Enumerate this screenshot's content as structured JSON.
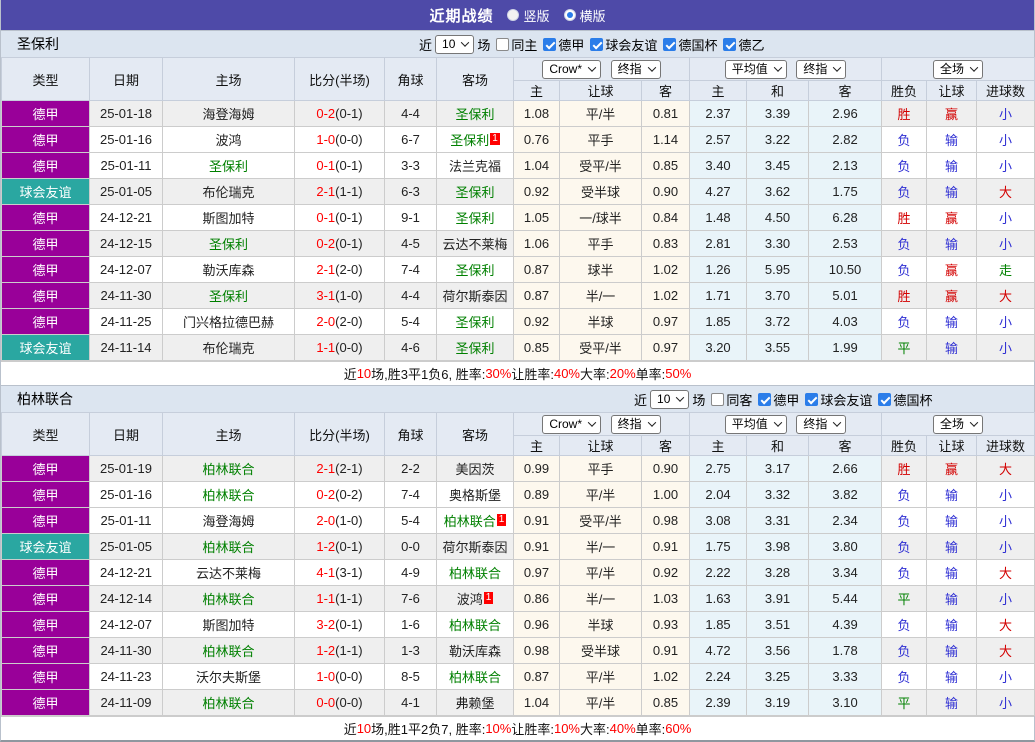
{
  "topbar": {
    "title": "近期战绩",
    "options": [
      {
        "label": "竖版",
        "selected": false
      },
      {
        "label": "横版",
        "selected": true
      }
    ]
  },
  "league_colors": {
    "德甲": "#990099",
    "球会友谊": "#2aa7a1"
  },
  "result_colors": {
    "胜": "#d30000",
    "赢": "#d30000",
    "大": "#d30000",
    "负": "#2f2fd3",
    "输": "#2f2fd3",
    "小": "#2f2fd3",
    "平": "#008000",
    "走": "#008000"
  },
  "team_color": "#008000",
  "score_color": "#ff0000",
  "table_header": {
    "main": [
      "类型",
      "日期",
      "主场",
      "比分(半场)",
      "角球",
      "客场"
    ],
    "group1_selects": [
      "Crow*",
      "终指"
    ],
    "group2_selects": [
      "平均值",
      "终指"
    ],
    "group3_selects": [
      "全场"
    ],
    "sub": [
      "主",
      "让球",
      "客",
      "主",
      "和",
      "客",
      "胜负",
      "让球",
      "进球数"
    ]
  },
  "sections": [
    {
      "team": "圣保利",
      "filter": {
        "prefix": "近",
        "count": "10",
        "suffix": "场",
        "same": "同主",
        "same_checked": false,
        "leagues": [
          "德甲",
          "球会友谊",
          "德国杯",
          "德乙"
        ]
      },
      "rows": [
        {
          "type": "德甲",
          "date": "25-01-18",
          "home": "海登海姆",
          "score": "0-2",
          "half": "(0-1)",
          "corner": "4-4",
          "away": "圣保利",
          "o1": "1.08",
          "handicap": "平/半",
          "o2": "0.81",
          "avg": [
            "2.37",
            "3.39",
            "2.96"
          ],
          "res": [
            "胜",
            "赢",
            "小"
          ]
        },
        {
          "type": "德甲",
          "date": "25-01-16",
          "home": "波鸿",
          "score": "1-0",
          "half": "(0-0)",
          "corner": "6-7",
          "away": "圣保利",
          "away_badge": "1",
          "o1": "0.76",
          "handicap": "平手",
          "o2": "1.14",
          "avg": [
            "2.57",
            "3.22",
            "2.82"
          ],
          "res": [
            "负",
            "输",
            "小"
          ]
        },
        {
          "type": "德甲",
          "date": "25-01-11",
          "home": "圣保利",
          "score": "0-1",
          "half": "(0-1)",
          "corner": "3-3",
          "away": "法兰克福",
          "o1": "1.04",
          "handicap": "受平/半",
          "o2": "0.85",
          "avg": [
            "3.40",
            "3.45",
            "2.13"
          ],
          "res": [
            "负",
            "输",
            "小"
          ]
        },
        {
          "type": "球会友谊",
          "date": "25-01-05",
          "home": "布伦瑞克",
          "score": "2-1",
          "half": "(1-1)",
          "corner": "6-3",
          "away": "圣保利",
          "o1": "0.92",
          "handicap": "受半球",
          "o2": "0.90",
          "avg": [
            "4.27",
            "3.62",
            "1.75"
          ],
          "res": [
            "负",
            "输",
            "大"
          ]
        },
        {
          "type": "德甲",
          "date": "24-12-21",
          "home": "斯图加特",
          "score": "0-1",
          "half": "(0-1)",
          "corner": "9-1",
          "away": "圣保利",
          "o1": "1.05",
          "handicap": "一/球半",
          "o2": "0.84",
          "avg": [
            "1.48",
            "4.50",
            "6.28"
          ],
          "res": [
            "胜",
            "赢",
            "小"
          ]
        },
        {
          "type": "德甲",
          "date": "24-12-15",
          "home": "圣保利",
          "score": "0-2",
          "half": "(0-1)",
          "corner": "4-5",
          "away": "云达不莱梅",
          "o1": "1.06",
          "handicap": "平手",
          "o2": "0.83",
          "avg": [
            "2.81",
            "3.30",
            "2.53"
          ],
          "res": [
            "负",
            "输",
            "小"
          ]
        },
        {
          "type": "德甲",
          "date": "24-12-07",
          "home": "勒沃库森",
          "score": "2-1",
          "half": "(2-0)",
          "corner": "7-4",
          "away": "圣保利",
          "o1": "0.87",
          "handicap": "球半",
          "o2": "1.02",
          "avg": [
            "1.26",
            "5.95",
            "10.50"
          ],
          "res": [
            "负",
            "赢",
            "走"
          ]
        },
        {
          "type": "德甲",
          "date": "24-11-30",
          "home": "圣保利",
          "score": "3-1",
          "half": "(1-0)",
          "corner": "4-4",
          "away": "荷尔斯泰因",
          "o1": "0.87",
          "handicap": "半/一",
          "o2": "1.02",
          "avg": [
            "1.71",
            "3.70",
            "5.01"
          ],
          "res": [
            "胜",
            "赢",
            "大"
          ]
        },
        {
          "type": "德甲",
          "date": "24-11-25",
          "home": "门兴格拉德巴赫",
          "score": "2-0",
          "half": "(2-0)",
          "corner": "5-4",
          "away": "圣保利",
          "o1": "0.92",
          "handicap": "半球",
          "o2": "0.97",
          "avg": [
            "1.85",
            "3.72",
            "4.03"
          ],
          "res": [
            "负",
            "输",
            "小"
          ]
        },
        {
          "type": "球会友谊",
          "date": "24-11-14",
          "home": "布伦瑞克",
          "score": "1-1",
          "half": "(0-0)",
          "corner": "4-6",
          "away": "圣保利",
          "o1": "0.85",
          "handicap": "受平/半",
          "o2": "0.97",
          "avg": [
            "3.20",
            "3.55",
            "1.99"
          ],
          "res": [
            "平",
            "输",
            "小"
          ]
        }
      ],
      "summary": [
        {
          "t": "近"
        },
        {
          "t": "10",
          "r": 1
        },
        {
          "t": "场,胜3平1负6, 胜率:"
        },
        {
          "t": "30%",
          "r": 1
        },
        {
          "t": " 让胜率:"
        },
        {
          "t": "40%",
          "r": 1
        },
        {
          "t": " 大率:"
        },
        {
          "t": "20%",
          "r": 1
        },
        {
          "t": " 单率:"
        },
        {
          "t": "50%",
          "r": 1
        }
      ]
    },
    {
      "team": "柏林联合",
      "filter": {
        "prefix": "近",
        "count": "10",
        "suffix": "场",
        "same": "同客",
        "same_checked": false,
        "leagues": [
          "德甲",
          "球会友谊",
          "德国杯"
        ]
      },
      "rows": [
        {
          "type": "德甲",
          "date": "25-01-19",
          "home": "柏林联合",
          "score": "2-1",
          "half": "(2-1)",
          "corner": "2-2",
          "away": "美因茨",
          "o1": "0.99",
          "handicap": "平手",
          "o2": "0.90",
          "avg": [
            "2.75",
            "3.17",
            "2.66"
          ],
          "res": [
            "胜",
            "赢",
            "大"
          ]
        },
        {
          "type": "德甲",
          "date": "25-01-16",
          "home": "柏林联合",
          "score": "0-2",
          "half": "(0-2)",
          "corner": "7-4",
          "away": "奥格斯堡",
          "o1": "0.89",
          "handicap": "平/半",
          "o2": "1.00",
          "avg": [
            "2.04",
            "3.32",
            "3.82"
          ],
          "res": [
            "负",
            "输",
            "小"
          ]
        },
        {
          "type": "德甲",
          "date": "25-01-11",
          "home": "海登海姆",
          "score": "2-0",
          "half": "(1-0)",
          "corner": "5-4",
          "away": "柏林联合",
          "away_badge": "1",
          "o1": "0.91",
          "handicap": "受平/半",
          "o2": "0.98",
          "avg": [
            "3.08",
            "3.31",
            "2.34"
          ],
          "res": [
            "负",
            "输",
            "小"
          ]
        },
        {
          "type": "球会友谊",
          "date": "25-01-05",
          "home": "柏林联合",
          "score": "1-2",
          "half": "(0-1)",
          "corner": "0-0",
          "away": "荷尔斯泰因",
          "o1": "0.91",
          "handicap": "半/一",
          "o2": "0.91",
          "avg": [
            "1.75",
            "3.98",
            "3.80"
          ],
          "res": [
            "负",
            "输",
            "小"
          ]
        },
        {
          "type": "德甲",
          "date": "24-12-21",
          "home": "云达不莱梅",
          "score": "4-1",
          "half": "(3-1)",
          "corner": "4-9",
          "away": "柏林联合",
          "o1": "0.97",
          "handicap": "平/半",
          "o2": "0.92",
          "avg": [
            "2.22",
            "3.28",
            "3.34"
          ],
          "res": [
            "负",
            "输",
            "大"
          ]
        },
        {
          "type": "德甲",
          "date": "24-12-14",
          "home": "柏林联合",
          "score": "1-1",
          "half": "(1-1)",
          "corner": "7-6",
          "away": "波鸿",
          "away_badge": "1",
          "o1": "0.86",
          "handicap": "半/一",
          "o2": "1.03",
          "avg": [
            "1.63",
            "3.91",
            "5.44"
          ],
          "res": [
            "平",
            "输",
            "小"
          ]
        },
        {
          "type": "德甲",
          "date": "24-12-07",
          "home": "斯图加特",
          "score": "3-2",
          "half": "(0-1)",
          "corner": "1-6",
          "away": "柏林联合",
          "o1": "0.96",
          "handicap": "半球",
          "o2": "0.93",
          "avg": [
            "1.85",
            "3.51",
            "4.39"
          ],
          "res": [
            "负",
            "输",
            "大"
          ]
        },
        {
          "type": "德甲",
          "date": "24-11-30",
          "home": "柏林联合",
          "score": "1-2",
          "half": "(1-1)",
          "corner": "1-3",
          "away": "勒沃库森",
          "o1": "0.98",
          "handicap": "受半球",
          "o2": "0.91",
          "avg": [
            "4.72",
            "3.56",
            "1.78"
          ],
          "res": [
            "负",
            "输",
            "大"
          ]
        },
        {
          "type": "德甲",
          "date": "24-11-23",
          "home": "沃尔夫斯堡",
          "score": "1-0",
          "half": "(0-0)",
          "corner": "8-5",
          "away": "柏林联合",
          "o1": "0.87",
          "handicap": "平/半",
          "o2": "1.02",
          "avg": [
            "2.24",
            "3.25",
            "3.33"
          ],
          "res": [
            "负",
            "输",
            "小"
          ]
        },
        {
          "type": "德甲",
          "date": "24-11-09",
          "home": "柏林联合",
          "score": "0-0",
          "half": "(0-0)",
          "corner": "4-1",
          "away": "弗赖堡",
          "o1": "1.04",
          "handicap": "平/半",
          "o2": "0.85",
          "avg": [
            "2.39",
            "3.19",
            "3.10"
          ],
          "res": [
            "平",
            "输",
            "小"
          ]
        }
      ],
      "summary": [
        {
          "t": "近"
        },
        {
          "t": "10",
          "r": 1
        },
        {
          "t": "场,胜1平2负7, 胜率:"
        },
        {
          "t": "10%",
          "r": 1
        },
        {
          "t": " 让胜率:"
        },
        {
          "t": "10%",
          "r": 1
        },
        {
          "t": " 大率:"
        },
        {
          "t": "40%",
          "r": 1
        },
        {
          "t": " 单率:"
        },
        {
          "t": "60%",
          "r": 1
        }
      ]
    }
  ]
}
